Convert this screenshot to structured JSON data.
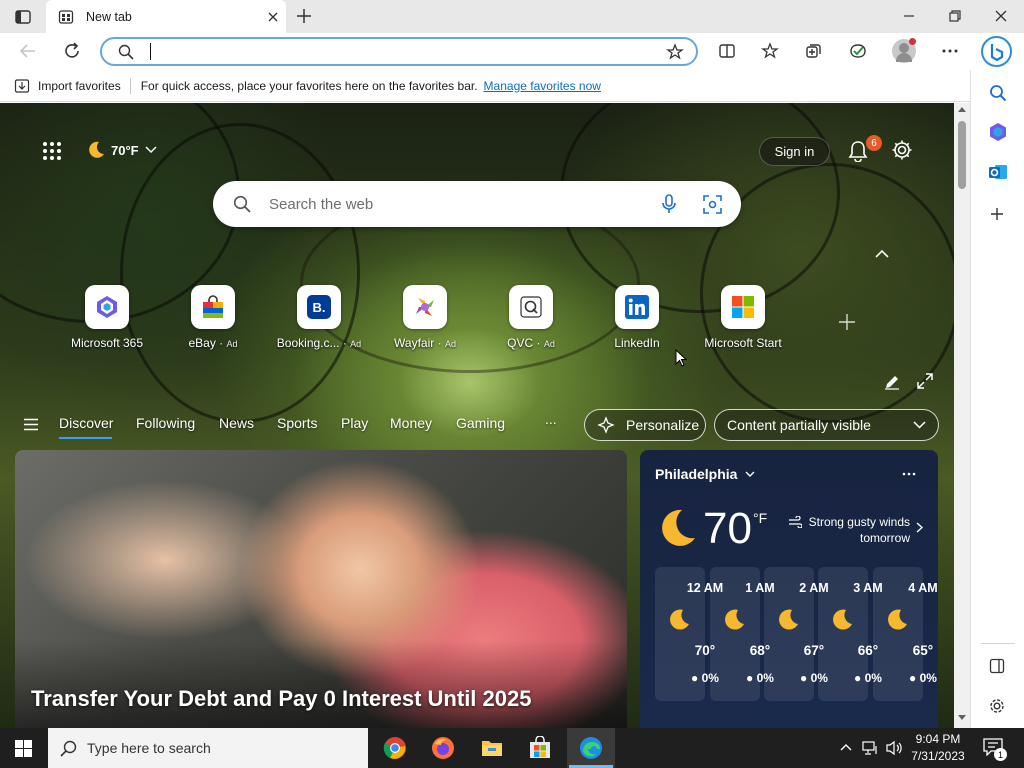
{
  "browser": {
    "tab_title": "New tab",
    "address_value": "",
    "favorites_bar": {
      "import_label": "Import favorites",
      "message": "For quick access, place your favorites here on the favorites bar.",
      "manage_link": "Manage favorites now"
    }
  },
  "page": {
    "weather_chip": "70°F",
    "sign_in": "Sign in",
    "notification_count": "6",
    "search_placeholder": "Search the web",
    "quick_links": [
      {
        "label": "Microsoft 365",
        "ad": ""
      },
      {
        "label": "eBay",
        "ad": "Ad"
      },
      {
        "label": "Booking.c...",
        "ad": "Ad"
      },
      {
        "label": "Wayfair",
        "ad": "Ad"
      },
      {
        "label": "QVC",
        "ad": "Ad"
      },
      {
        "label": "LinkedIn",
        "ad": ""
      },
      {
        "label": "Microsoft Start",
        "ad": ""
      }
    ],
    "nav": [
      "Discover",
      "Following",
      "News",
      "Sports",
      "Play",
      "Money",
      "Gaming",
      "..."
    ],
    "personalize": "Personalize",
    "content_visibility": "Content partially visible",
    "headline": "Transfer Your Debt and Pay 0 Interest Until 2025",
    "weather": {
      "city": "Philadelphia",
      "temp": "70",
      "unit": "°F",
      "forecast_line1": "Strong gusty winds",
      "forecast_line2": "tomorrow",
      "hours": [
        {
          "time": "12 AM",
          "temp": "70°",
          "precip": "0%"
        },
        {
          "time": "1 AM",
          "temp": "68°",
          "precip": "0%"
        },
        {
          "time": "2 AM",
          "temp": "67°",
          "precip": "0%"
        },
        {
          "time": "3 AM",
          "temp": "66°",
          "precip": "0%"
        },
        {
          "time": "4 AM",
          "temp": "65°",
          "precip": "0%"
        }
      ]
    }
  },
  "taskbar": {
    "search_placeholder": "Type here to search",
    "time": "9:04 PM",
    "date": "7/31/2023",
    "notification_badge": "1"
  },
  "colors": {
    "accent": "#0f6cbd",
    "link": "#0f6cbd",
    "notification": "#e8592b",
    "taskbar": "#1f1f1f"
  }
}
